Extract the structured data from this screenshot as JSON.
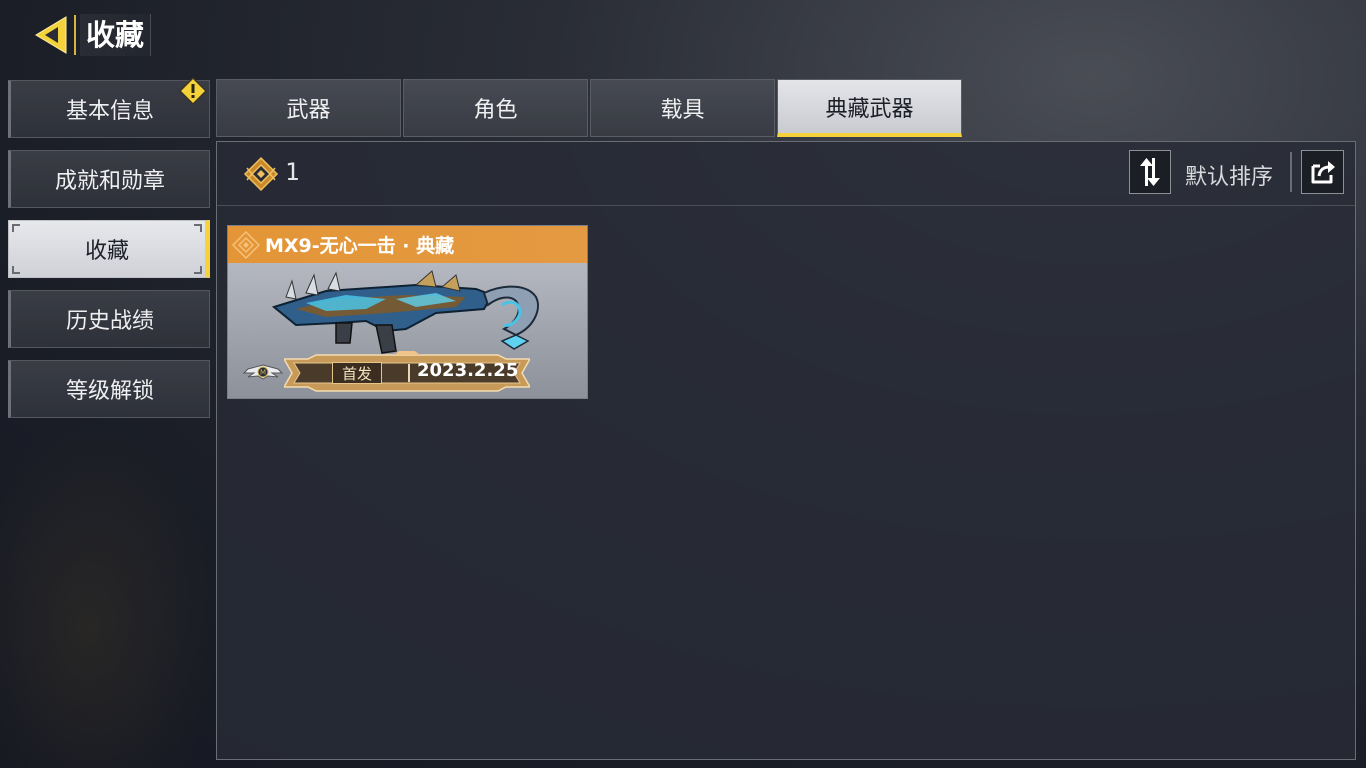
{
  "header": {
    "title": "收藏"
  },
  "sidebar": {
    "items": [
      {
        "label": "基本信息",
        "active": false,
        "warning": true
      },
      {
        "label": "成就和勋章",
        "active": false
      },
      {
        "label": "收藏",
        "active": true
      },
      {
        "label": "历史战绩",
        "active": false
      },
      {
        "label": "等级解锁",
        "active": false
      }
    ]
  },
  "tabs": [
    {
      "label": "武器",
      "active": false
    },
    {
      "label": "角色",
      "active": false
    },
    {
      "label": "载具",
      "active": false
    },
    {
      "label": "典藏武器",
      "active": true
    }
  ],
  "panel": {
    "count": "1",
    "sort_label": "默认排序"
  },
  "cards": [
    {
      "title": "MX9-无心一击 · 典藏",
      "tag": "首发",
      "date": "2023.2.25"
    }
  ],
  "colors": {
    "accent_yellow": "#f3d23c",
    "card_orange": "#e39537",
    "panel_bg": "#282b36"
  }
}
